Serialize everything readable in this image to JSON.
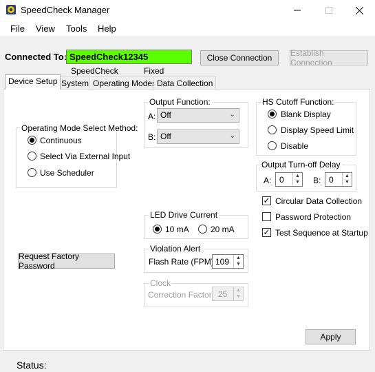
{
  "window": {
    "title": "SpeedCheck Manager",
    "icon": "app-logo-icon",
    "controls": [
      "minimize-icon",
      "maximize-icon",
      "close-icon"
    ]
  },
  "menu": {
    "file": "File",
    "view": "View",
    "tools": "Tools",
    "help": "Help"
  },
  "connection": {
    "label": "Connected To:",
    "device_id": "SpeedCheck12345",
    "close_button": "Close Connection",
    "establish_button": "Establish Connection",
    "device_name": "SpeedCheck",
    "device_mode": "Fixed",
    "field_color": "#5cff00"
  },
  "tabs": {
    "device_setup": "Device Setup",
    "system": "System",
    "operating_modes": "Operating Modes",
    "data_collection": "Data Collection"
  },
  "operating_mode": {
    "title": "Operating Mode Select Method:",
    "continuous": "Continuous",
    "external": "Select Via External Input",
    "scheduler": "Use Scheduler",
    "selected": "continuous"
  },
  "output_function": {
    "title": "Output Function:",
    "a_label": "A:",
    "a_value": "Off",
    "b_label": "B:",
    "b_value": "Off"
  },
  "hs_cutoff": {
    "title": "HS Cutoff Function:",
    "blank": "Blank Display",
    "speed_limit": "Display Speed Limit",
    "disable": "Disable",
    "selected": "blank"
  },
  "turnoff_delay": {
    "title": "Output Turn-off Delay",
    "a_label": "A:",
    "a_value": "0",
    "b_label": "B:",
    "b_value": "0"
  },
  "options": {
    "circular": "Circular Data Collection",
    "circular_checked": true,
    "password": "Password Protection",
    "password_checked": false,
    "test_sequence": "Test Sequence at Startup",
    "test_sequence_checked": true
  },
  "led_drive": {
    "title": "LED Drive Current",
    "opt_10": "10 mA",
    "opt_20": "20 mA",
    "selected": "10"
  },
  "violation": {
    "title": "Violation Alert",
    "flash_label": "Flash Rate (FPM):",
    "flash_value": "109"
  },
  "clock": {
    "title": "Clock",
    "correction_label": "Correction Factor:",
    "correction_value": "25"
  },
  "buttons": {
    "factory_password": "Request Factory Password",
    "apply": "Apply"
  },
  "status": {
    "label": "Status:"
  }
}
